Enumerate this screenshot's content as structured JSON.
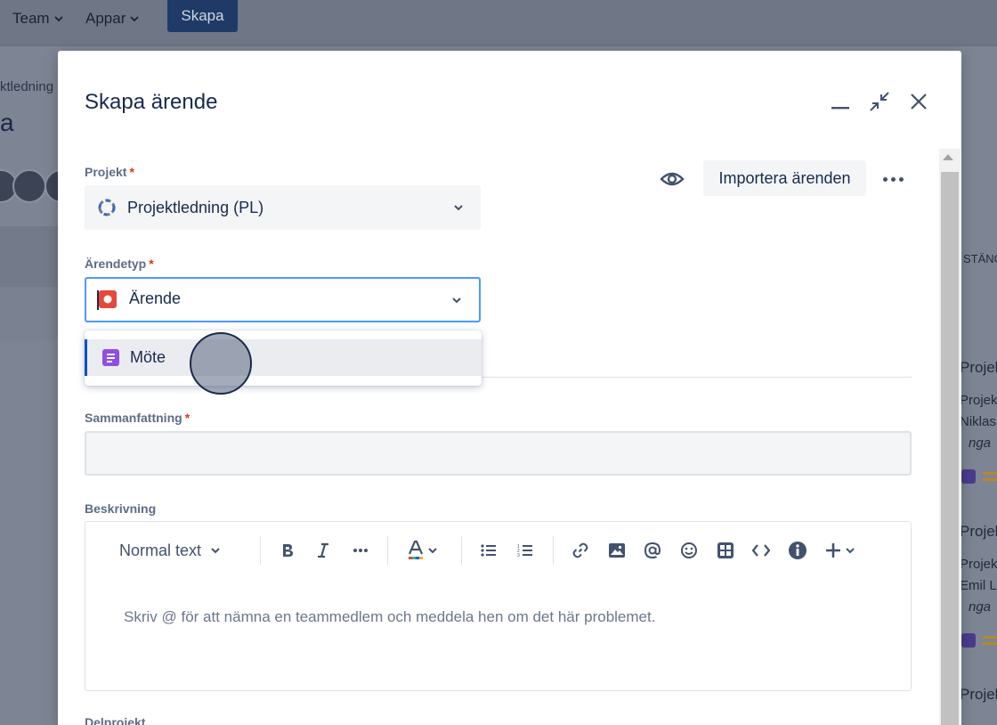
{
  "topnav": {
    "team": "Team",
    "apps": "Appar",
    "create": "Skapa"
  },
  "background": {
    "breadcrumb": "ktledning",
    "heading": "a",
    "column_header": "STÄNG",
    "cards": [
      {
        "title": "Projek",
        "line1": "Projek",
        "line2": "Niklas",
        "line3": "nga"
      },
      {
        "title": "Projek",
        "line1": "Projek",
        "line2": "Emil L",
        "line3": "nga"
      },
      {
        "title": "Projek"
      }
    ]
  },
  "modal": {
    "title": "Skapa ärende",
    "header_icons": [
      "minimize-icon",
      "collapse-icon",
      "close-icon"
    ],
    "project": {
      "label": "Projekt",
      "required_mark": "*",
      "value": "Projektledning (PL)"
    },
    "actions": {
      "import_label": "Importera ärenden"
    },
    "issue_type": {
      "label": "Ärendetyp",
      "required_mark": "*",
      "value": "Ärende",
      "options": [
        "Möte"
      ]
    },
    "summary": {
      "label": "Sammanfattning",
      "required_mark": "*",
      "value": ""
    },
    "description": {
      "label": "Beskrivning",
      "text_style": "Normal text",
      "placeholder": "Skriv @ för att nämna en teammedlem och meddela hen om det här problemet."
    },
    "subproject_label": "Delprojekt"
  },
  "colors": {
    "accent": "#0052cc",
    "focus_border": "#4c9aff",
    "issue_icon": "#e5493a",
    "meeting_icon": "#904ee2",
    "required": "#de350b",
    "create_button": "#1f3a66"
  }
}
